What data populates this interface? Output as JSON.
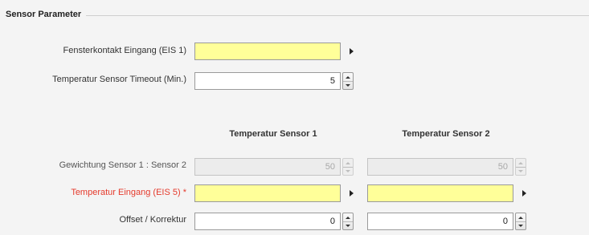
{
  "group": {
    "title": "Sensor Parameter"
  },
  "rows": {
    "window_contact": {
      "label": "Fensterkontakt Eingang (EIS 1)",
      "value": ""
    },
    "temp_timeout": {
      "label": "Temperatur Sensor Timeout (Min.)",
      "value": "5"
    },
    "weighting": {
      "label": "Gewichtung Sensor 1 : Sensor 2",
      "sensor1_value": "50",
      "sensor2_value": "50"
    },
    "temp_input": {
      "label": "Temperatur Eingang (EIS 5) *",
      "sensor1_value": "",
      "sensor2_value": ""
    },
    "offset": {
      "label": "Offset / Korrektur",
      "sensor1_value": "0",
      "sensor2_value": "0"
    }
  },
  "columns": {
    "sensor1": "Temperatur Sensor 1",
    "sensor2": "Temperatur Sensor 2"
  },
  "colors": {
    "required_label": "#e53a2c",
    "input_highlight": "#ffff99"
  },
  "icons": {
    "select_arrow": "triangle-right-icon",
    "spin_up": "chevron-up-icon",
    "spin_down": "chevron-down-icon"
  }
}
